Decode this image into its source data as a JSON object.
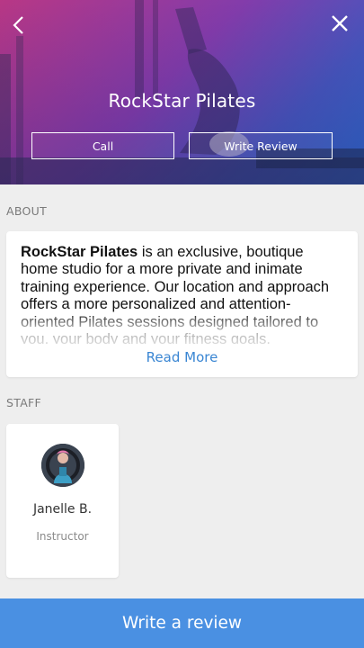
{
  "header": {
    "title": "RockStar Pilates",
    "call_label": "Call",
    "write_review_label": "Write Review",
    "back_icon": "chevron-left-icon",
    "close_icon": "close-icon"
  },
  "about": {
    "section_label": "ABOUT",
    "business_name": "RockStar Pilates",
    "description": " is an exclusive, boutique home studio for a more private and inimate training experience.  Our location and approach offers a more personalized and attention-oriented Pilates sessions designed tailored to you, your body and your fitness goals.",
    "read_more_label": "Read More"
  },
  "staff": {
    "section_label": "STAFF",
    "members": [
      {
        "name": "Janelle B.",
        "role": "Instructor"
      }
    ]
  },
  "footer": {
    "write_review_label": "Write a review"
  },
  "colors": {
    "accent": "#4a90e2",
    "link": "#3a86d3",
    "background": "#eeeeee"
  }
}
